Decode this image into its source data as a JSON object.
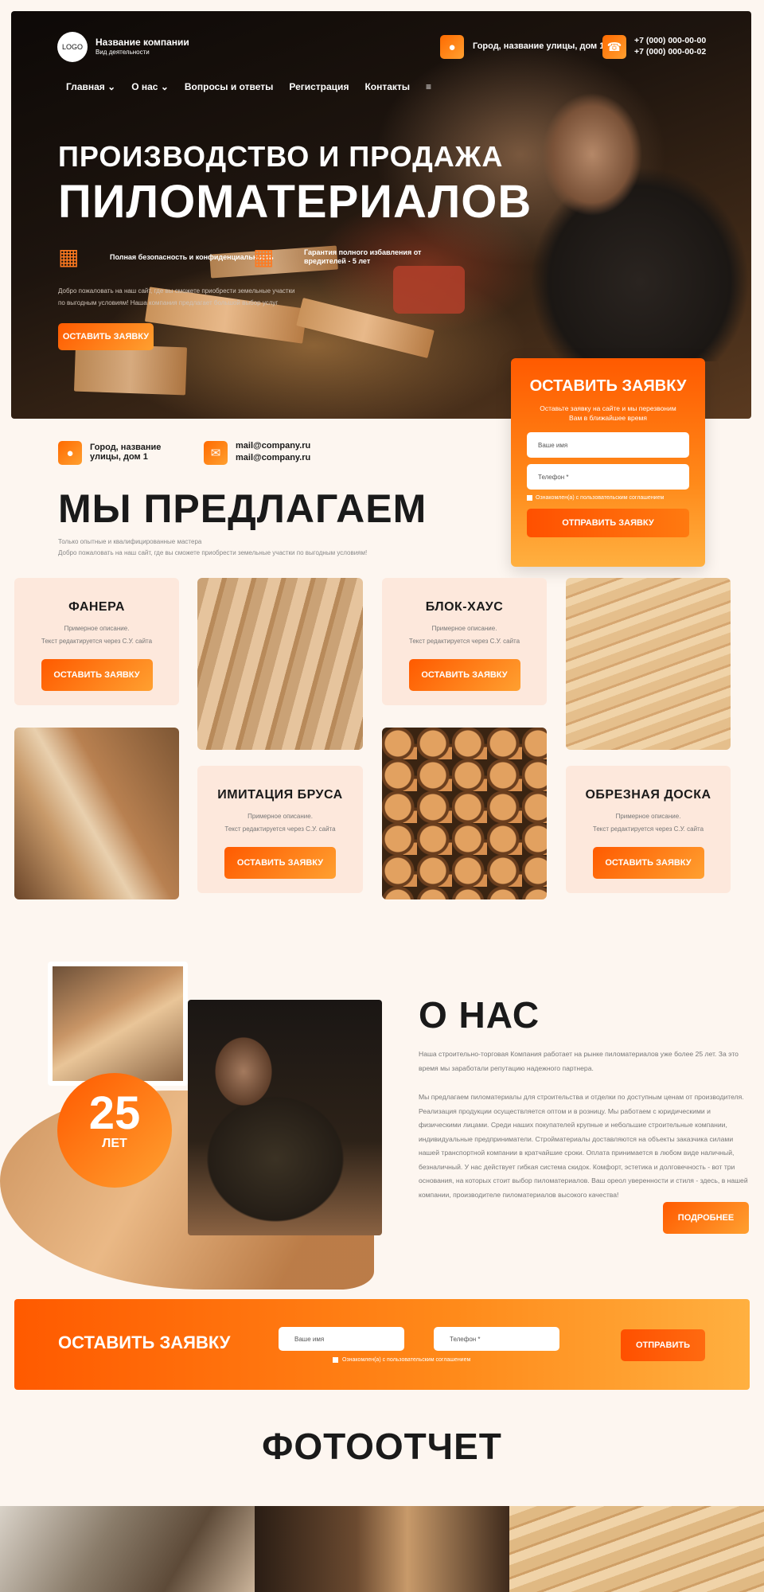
{
  "header": {
    "logo": "LOGO",
    "company_name": "Название компании",
    "company_sub": "Вид деятельности",
    "address": "Город, название улицы, дом 1",
    "phone1": "+7 (000) 000-00-00",
    "phone2": "+7 (000) 000-00-02",
    "nav": [
      "Главная",
      "О нас",
      "Вопросы и ответы",
      "Регистрация",
      "Контакты"
    ]
  },
  "hero": {
    "title_line1": "ПРОИЗВОДСТВО И ПРОДАЖА",
    "title_line2": "ПИЛОМАТЕРИАЛОВ",
    "feature1": "Полная безопасность и конфиденциальность",
    "feature2": "Гарантия полного избавления от вредителей - 5 лет",
    "desc": "Добро пожаловать на наш сайт, где вы сможете приобрести земельные участки по выгодным условиям! Наша компания предлагает большой выбор услуг",
    "button": "ОСТАВИТЬ ЗАЯВКУ"
  },
  "form_card": {
    "title": "ОСТАВИТЬ ЗАЯВКУ",
    "subtitle": "Оставьте заявку на сайте и мы перезвоним Вам в ближайшее время",
    "name_placeholder": "Ваше имя",
    "phone_placeholder": "Телефон *",
    "consent": "Ознакомлен(а) с пользовательским соглашением",
    "submit": "ОТПРАВИТЬ ЗАЯВКУ"
  },
  "contacts": {
    "address": "Город, название улицы, дом 1",
    "email1": "mail@company.ru",
    "email2": "mail@company.ru"
  },
  "offer": {
    "title": "МЫ ПРЕДЛАГАЕМ",
    "sub1": "Только опытные и квалифицированные мастера",
    "sub2": "Добро пожаловать на наш сайт, где вы сможете приобрести земельные участки по выгодным условиям!"
  },
  "products": [
    {
      "title": "ФАНЕРА",
      "desc1": "Примерное описание.",
      "desc2": "Текст редактируется через С.У. сайта",
      "button": "ОСТАВИТЬ ЗАЯВКУ"
    },
    {
      "title": "БЛОК-ХАУС",
      "desc1": "Примерное описание.",
      "desc2": "Текст редактируется через С.У. сайта",
      "button": "ОСТАВИТЬ ЗАЯВКУ"
    },
    {
      "title": "ИМИТАЦИЯ БРУСА",
      "desc1": "Примерное описание.",
      "desc2": "Текст редактируется через С.У. сайта",
      "button": "ОСТАВИТЬ ЗАЯВКУ"
    },
    {
      "title": "ОБРЕЗНАЯ ДОСКА",
      "desc1": "Примерное описание.",
      "desc2": "Текст редактируется через С.У. сайта",
      "button": "ОСТАВИТЬ ЗАЯВКУ"
    }
  ],
  "about": {
    "title": "О НАС",
    "years_num": "25",
    "years_label": "ЛЕТ",
    "p1": "Наша строительно-торговая Компания работает на рынке пиломатериалов уже более 25 лет. За это время мы заработали репутацию надежного партнера.",
    "p2": "Мы предлагаем пиломатериалы для строительства и отделки по доступным ценам от производителя. Реализация продукции осуществляется оптом и в розницу. Мы работаем с юридическими и физическими лицами. Среди наших покупателей крупные и небольшие строительные компании, индивидуальные предприниматели. Стройматериалы доставляются на объекты заказчика силами нашей транспортной компании в кратчайшие сроки. Оплата принимается в любом виде наличный, безналичный. У нас действует гибкая система скидок. Комфорт, эстетика и долговечность - вот три основания, на которых стоит выбор пиломатериалов. Ваш ореол уверенности и стиля - здесь, в нашей компании, производителе пиломатериалов высокого качества!",
    "button": "ПОДРОБНЕЕ"
  },
  "cta": {
    "title": "ОСТАВИТЬ  ЗАЯВКУ",
    "name_placeholder": "Ваше имя",
    "phone_placeholder": "Телефон *",
    "consent": "Ознакомлен(а) с пользовательским соглашением",
    "button": "ОТПРАВИТЬ"
  },
  "photo": {
    "title": "ФОТООТЧЕТ"
  },
  "colors": {
    "accent": "#ff6a00",
    "accent_light": "#ffa030",
    "bg": "#fdf6f0"
  }
}
